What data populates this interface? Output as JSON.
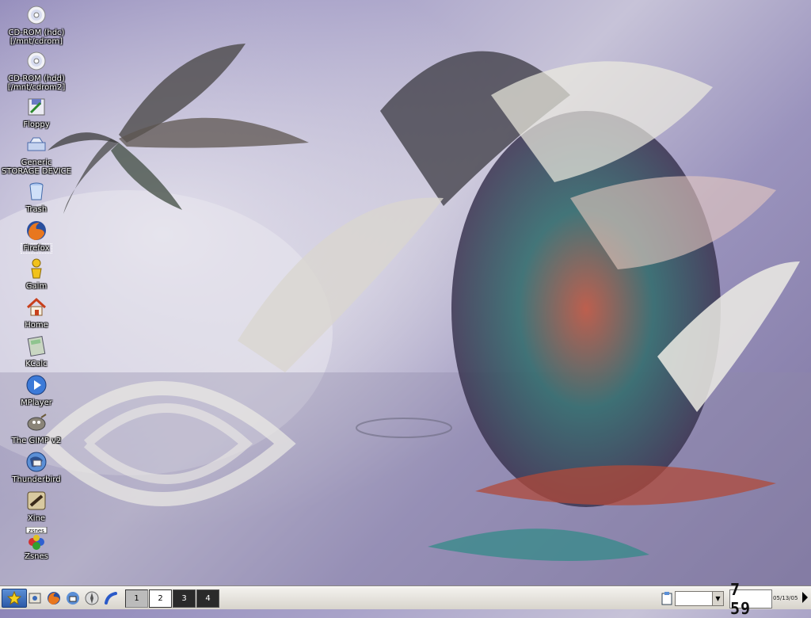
{
  "desktop": {
    "icons": [
      {
        "label1": "CD-ROM (hdc)",
        "label2": "[/mnt/cdrom]",
        "icon": "cdrom-icon"
      },
      {
        "label1": "CD-ROM (hdd)",
        "label2": "[/mnt/cdrom2]",
        "icon": "cdrom-icon"
      },
      {
        "label1": "Floppy",
        "label2": "",
        "icon": "floppy-icon"
      },
      {
        "label1": "Generic",
        "label2": "STORAGE DEVICE",
        "icon": "usb-storage-icon"
      },
      {
        "label1": "Trash",
        "label2": "",
        "icon": "trash-icon"
      },
      {
        "label1": "Firefox",
        "label2": "",
        "icon": "firefox-icon"
      },
      {
        "label1": "Gaim",
        "label2": "",
        "icon": "gaim-icon"
      },
      {
        "label1": "Home",
        "label2": "",
        "icon": "home-icon"
      },
      {
        "label1": "KCalc",
        "label2": "",
        "icon": "calculator-icon"
      },
      {
        "label1": "MPlayer",
        "label2": "",
        "icon": "mplayer-icon"
      },
      {
        "label1": "The GIMP v2",
        "label2": "",
        "icon": "gimp-icon"
      },
      {
        "label1": "Thunderbird",
        "label2": "",
        "icon": "thunderbird-icon"
      },
      {
        "label1": "Xine",
        "label2": "",
        "icon": "xine-icon"
      },
      {
        "label1": "Zsnes",
        "label2": "",
        "icon": "zsnes-icon"
      }
    ],
    "zsnes_badge": "zsnes",
    "selected_icon": "Firefox"
  },
  "taskbar": {
    "pager": [
      "1",
      "2",
      "3",
      "4"
    ],
    "active_desktop": "2",
    "clock": "7 59",
    "date": "05/13/05"
  },
  "colors": {
    "taskbar_bg": "#d8d4cc",
    "start_blue": "#2c5aa8"
  }
}
